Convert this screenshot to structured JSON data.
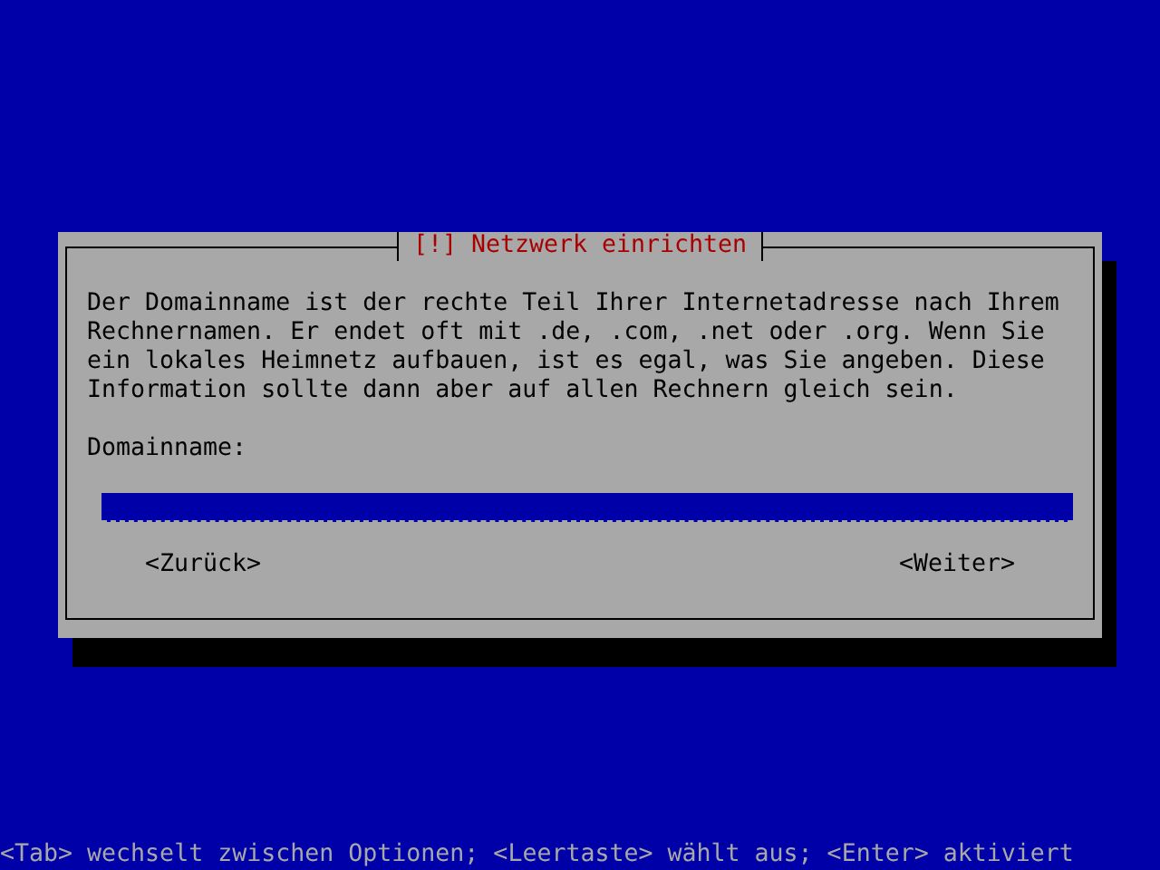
{
  "dialog": {
    "title": "[!] Netzwerk einrichten",
    "description": [
      "Der Domainname ist der rechte Teil Ihrer Internetadresse nach Ihrem",
      "Rechnernamen. Er endet oft mit .de, .com, .net oder .org. Wenn Sie",
      "ein lokales Heimnetz aufbauen, ist es egal, was Sie angeben. Diese",
      "Information sollte dann aber auf allen Rechnern gleich sein."
    ],
    "field": {
      "label": "Domainname:"
    },
    "buttons": [
      {
        "label": "<Zurück>",
        "selected": false
      },
      {
        "label": "<Weiter>",
        "selected": false
      }
    ]
  },
  "status_bar": "<Tab> wechselt zwischen Optionen; <Leertaste> wählt aus; <Enter> aktiviert"
}
